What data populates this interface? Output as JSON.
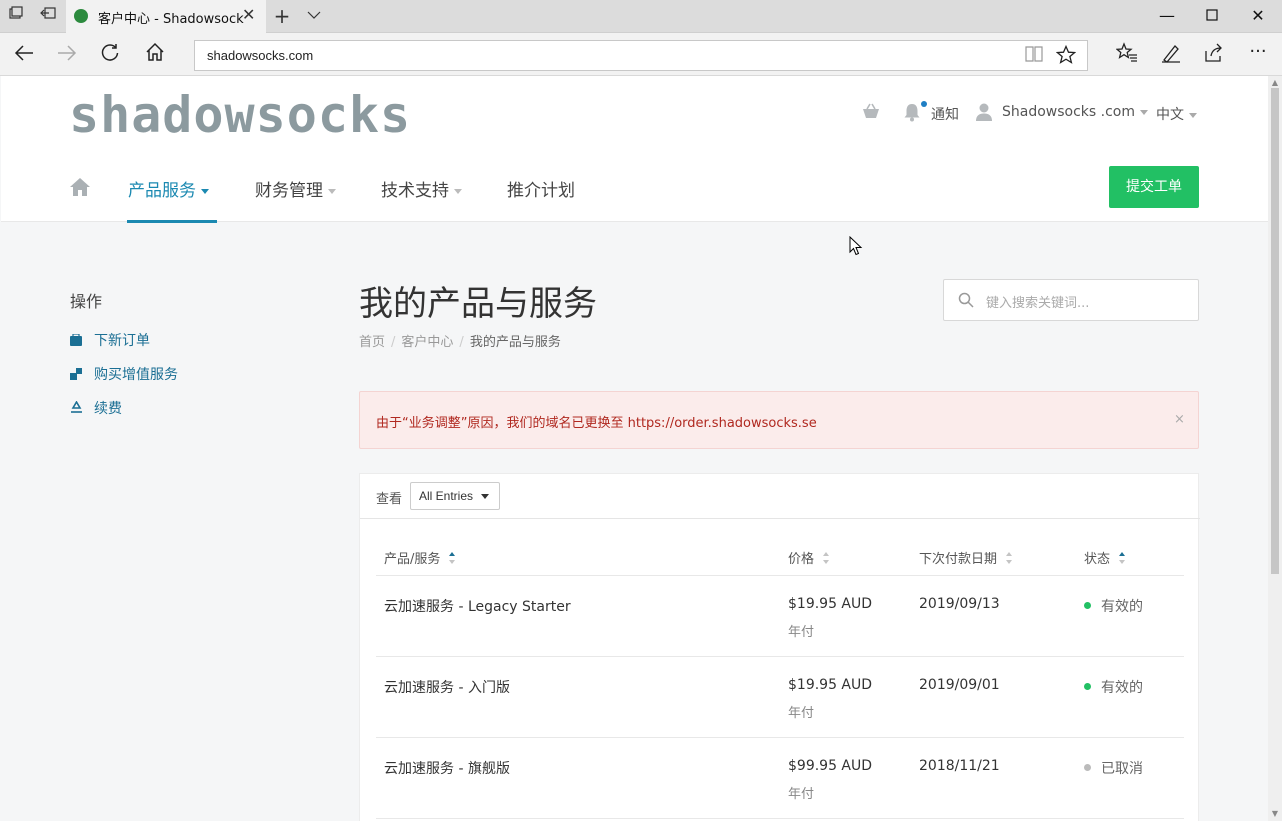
{
  "browser": {
    "tab_title": "客户中心 - Shadowsock",
    "url": "shadowsocks.com"
  },
  "header": {
    "logo": "shadowsocks",
    "notifications_label": "通知",
    "account_label": "Shadowsocks .com",
    "language_label": "中文"
  },
  "nav": {
    "products": "产品服务",
    "billing": "财务管理",
    "support": "技术支持",
    "affiliates": "推介计划",
    "open_ticket": "提交工单"
  },
  "sidebar": {
    "title": "操作",
    "items": [
      {
        "label": "下新订单"
      },
      {
        "label": "购买增值服务"
      },
      {
        "label": "续费"
      }
    ]
  },
  "main": {
    "title": "我的产品与服务",
    "breadcrumb": [
      "首页",
      "客户中心",
      "我的产品与服务"
    ],
    "search_placeholder": "键入搜索关键词...",
    "alert": "由于“业务调整”原因，我们的域名已更换至 https://order.shadowsocks.se",
    "alert_close": "×",
    "view_label": "查看",
    "view_select": "All Entries"
  },
  "table": {
    "headers": [
      "产品/服务",
      "价格",
      "下次付款日期",
      "状态"
    ],
    "rows": [
      {
        "product": "云加速服务 - Legacy Starter",
        "price": "$19.95 AUD",
        "cycle": "年付",
        "due": "2019/09/13",
        "status": "有效的",
        "status_color": "#22c064"
      },
      {
        "product": "云加速服务 - 入门版",
        "price": "$19.95 AUD",
        "cycle": "年付",
        "due": "2019/09/01",
        "status": "有效的",
        "status_color": "#22c064"
      },
      {
        "product": "云加速服务 - 旗舰版",
        "price": "$99.95 AUD",
        "cycle": "年付",
        "due": "2018/11/21",
        "status": "已取消",
        "status_color": "#bbbbbb"
      }
    ]
  },
  "colors": {
    "accent": "#1b89b1",
    "button_green": "#22c064",
    "alert_text": "#b0281f"
  }
}
